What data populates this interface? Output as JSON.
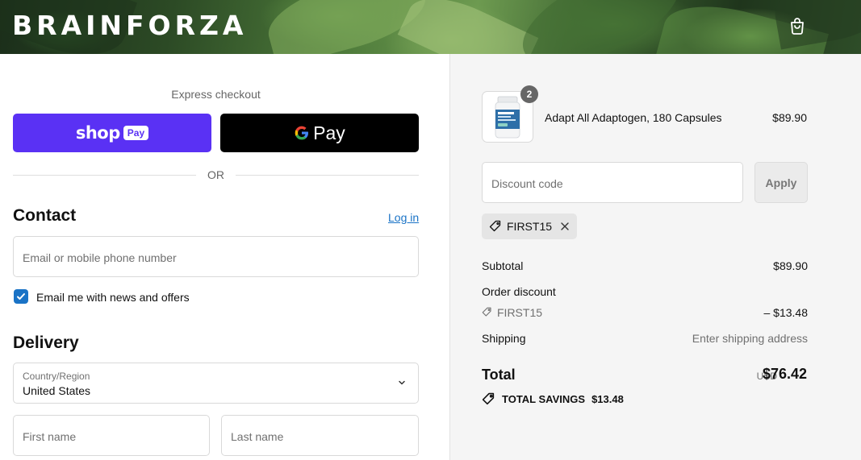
{
  "header": {
    "logo": "BRAINFORZA",
    "cart_icon": "shopping-bag-icon"
  },
  "express": {
    "label": "Express checkout",
    "shop_pay_text": "shop",
    "shop_pay_badge": "Pay",
    "gpay_text": "Pay",
    "divider_text": "OR"
  },
  "contact": {
    "title": "Contact",
    "login_link": "Log in",
    "email_placeholder": "Email or mobile phone number",
    "newsletter_label": "Email me with news and offers",
    "newsletter_checked": true
  },
  "delivery": {
    "title": "Delivery",
    "country_label": "Country/Region",
    "country_value": "United States",
    "first_name_placeholder": "First name",
    "last_name_placeholder": "Last name"
  },
  "order": {
    "item": {
      "name": "Adapt All Adaptogen, 180 Capsules",
      "price": "$89.90",
      "quantity": "2"
    },
    "discount_placeholder": "Discount code",
    "apply_label": "Apply",
    "applied_code": "FIRST15",
    "subtotal_label": "Subtotal",
    "subtotal_value": "$89.90",
    "order_discount_label": "Order discount",
    "discount_code": "FIRST15",
    "discount_value": "– $13.48",
    "shipping_label": "Shipping",
    "shipping_value": "Enter shipping address",
    "total_label": "Total",
    "currency": "USD",
    "total_value": "$76.42",
    "savings_label": "TOTAL SAVINGS",
    "savings_value": "$13.48"
  },
  "colors": {
    "shop_pay": "#5a31f4",
    "link": "#1a73c6",
    "summary_bg": "#f5f5f5"
  }
}
